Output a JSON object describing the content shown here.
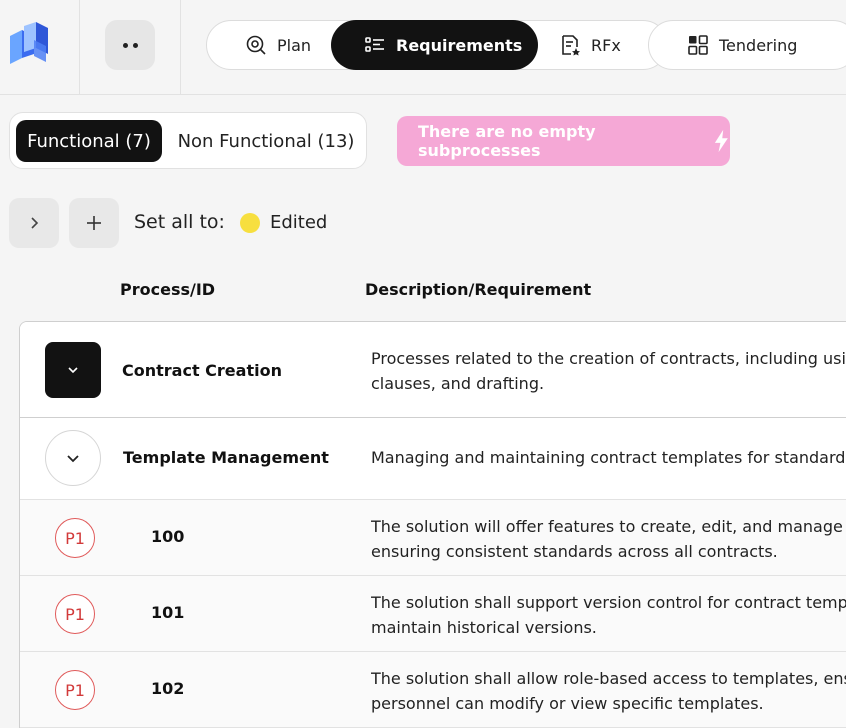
{
  "colors": {
    "accent_dark": "#121212",
    "notice_pink": "#f5a8d6",
    "status_edited": "#f7df3f",
    "priority_red": "#d23a3a",
    "logo_blue": "#3b6cf0"
  },
  "menu": {
    "icon": "more-dots-icon"
  },
  "nav": {
    "tabs": [
      {
        "label": "Plan",
        "icon": "plan-search-icon",
        "active": false
      },
      {
        "label": "Requirements",
        "icon": "requirements-list-icon",
        "active": true
      },
      {
        "label": "RFx",
        "icon": "rfx-document-icon",
        "active": false
      },
      {
        "label": "Tendering",
        "icon": "tendering-grid-icon",
        "active": false
      }
    ]
  },
  "filters": {
    "functional": "Functional (7)",
    "non_functional": "Non Functional (13)",
    "notice": "There are no empty subprocesses"
  },
  "actions": {
    "set_all_label": "Set all to:",
    "status_label": "Edited"
  },
  "table": {
    "headers": {
      "process": "Process/ID",
      "description": "Description/Requirement"
    },
    "process": {
      "name": "Contract Creation",
      "desc1": "Processes related to the creation of contracts, including using te",
      "desc2": "clauses, and drafting."
    },
    "subprocess": {
      "name": "Template Management",
      "desc": "Managing and maintaining contract templates for standardiza"
    },
    "requirements": [
      {
        "priority": "P1",
        "id": "100",
        "line1": "The solution will offer features to create, edit, and manage con",
        "line2": "ensuring consistent standards across all contracts."
      },
      {
        "priority": "P1",
        "id": "101",
        "line1": "The solution shall support version control for contract template",
        "line2": "maintain historical versions."
      },
      {
        "priority": "P1",
        "id": "102",
        "line1": "The solution shall allow role-based access to templates, ensurin",
        "line2": "personnel can modify or view specific templates."
      }
    ]
  }
}
